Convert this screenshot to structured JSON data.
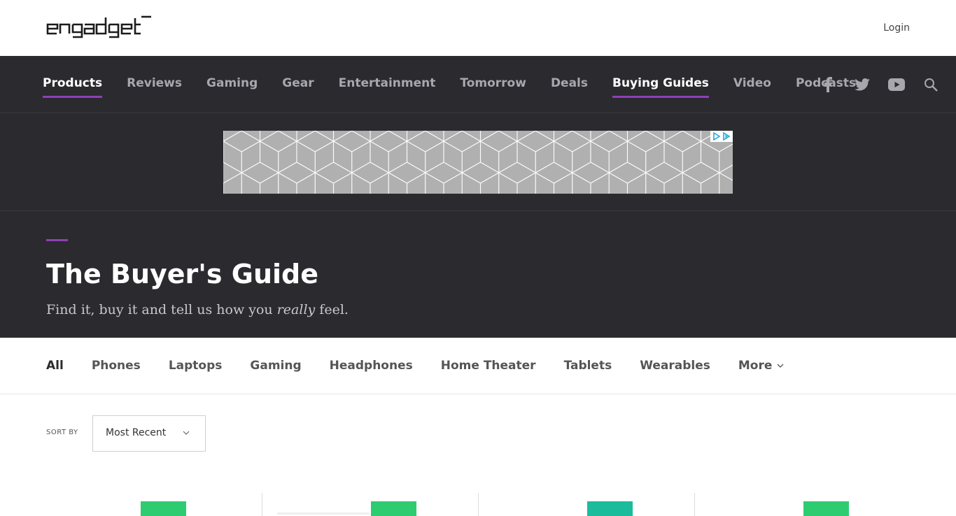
{
  "brand": {
    "logo_text": "engadget"
  },
  "header": {
    "login_label": "Login"
  },
  "nav": {
    "items": [
      {
        "label": "Products",
        "active": true
      },
      {
        "label": "Reviews",
        "active": false
      },
      {
        "label": "Gaming",
        "active": false
      },
      {
        "label": "Gear",
        "active": false
      },
      {
        "label": "Entertainment",
        "active": false
      },
      {
        "label": "Tomorrow",
        "active": false
      },
      {
        "label": "Deals",
        "active": false
      },
      {
        "label": "Buying Guides",
        "active": true
      },
      {
        "label": "Video",
        "active": false
      },
      {
        "label": "Podcasts",
        "active": false
      }
    ],
    "social_icons": [
      "facebook-icon",
      "twitter-icon",
      "youtube-icon",
      "search-icon"
    ]
  },
  "hero": {
    "title": "The Buyer's Guide",
    "subtitle_before": "Find it, buy it and tell us how you ",
    "subtitle_emphasis": "really",
    "subtitle_after": " feel."
  },
  "categories": {
    "items": [
      "All",
      "Phones",
      "Laptops",
      "Gaming",
      "Headphones",
      "Home Theater",
      "Tablets",
      "Wearables"
    ],
    "more_label": "More"
  },
  "sort": {
    "label": "SORT BY",
    "selected": "Most Recent"
  },
  "cards": {
    "badge_colors": [
      "#2ecc71",
      "#2ecc71",
      "#1abc9c",
      "#2ecc71"
    ]
  },
  "colors": {
    "accent": "#8e40b6",
    "nav_bg": "#2a2a2f",
    "nav_text": "#a7a7ad",
    "nav_text_active": "#ffffff"
  }
}
